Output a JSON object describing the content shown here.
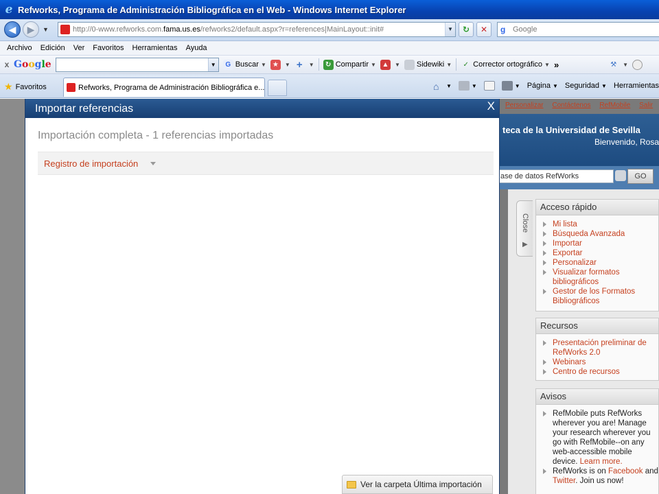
{
  "window": {
    "title": "Refworks, Programa de Administración Bibliográfica en el Web - Windows Internet Explorer"
  },
  "address": {
    "url_prefix": "http://0-www.refworks.com.",
    "url_domain": "fama.us.es",
    "url_suffix": "/refworks2/default.aspx?r=references|MainLayout::init#",
    "search_placeholder": "Google"
  },
  "menu": [
    "Archivo",
    "Edición",
    "Ver",
    "Favoritos",
    "Herramientas",
    "Ayuda"
  ],
  "google_toolbar": {
    "close": "x",
    "logo": [
      "G",
      "o",
      "o",
      "g",
      "l",
      "e"
    ],
    "buscar": "Buscar",
    "compartir": "Compartir",
    "sidewiki": "Sidewiki",
    "corrector": "Corrector ortográfico",
    "more": "»"
  },
  "tabs": {
    "favorites": "Favoritos",
    "active_tab": "Refworks, Programa de Administración Bibliográfica e...",
    "commands": [
      "Página",
      "Seguridad",
      "Herramientas"
    ]
  },
  "site": {
    "top_links": [
      "Personalizar",
      "Contáctenos",
      "RefMobile",
      "Salir"
    ],
    "library_title": "teca de la Universidad de Sevilla",
    "welcome": "Bienvenido, Rosa",
    "search_text": "ase de datos RefWorks",
    "go_label": "GO",
    "close_tab": "Close",
    "panels": {
      "quick_access": {
        "title": "Acceso rápido",
        "items": [
          "Mi lista",
          "Búsqueda Avanzada",
          "Importar",
          "Exportar",
          "Personalizar",
          "Visualizar formatos bibliográficos",
          "Gestor de los Formatos Bibliográficos"
        ]
      },
      "resources": {
        "title": "Recursos",
        "items": [
          "Presentación preliminar de RefWorks 2.0",
          "Webinars",
          "Centro de recursos"
        ]
      },
      "notices": {
        "title": "Avisos",
        "text1": "RefMobile puts RefWorks wherever you are! Manage your research wherever you go with RefMobile--on any web-accessible mobile device.",
        "learn_more": "Learn more.",
        "text2_prefix": "RefWorks is on",
        "facebook": "Facebook",
        "text2_mid": "and",
        "twitter": "Twitter",
        "text2_end": ". Join us now!"
      }
    }
  },
  "modal": {
    "title": "Importar referencias",
    "close": "X",
    "status": "Importación completa - 1 referencias importadas",
    "log_label": "Registro de importación",
    "folder_button": "Ver la carpeta Última importación"
  },
  "colors": {
    "title_bar": "#0842b0",
    "modal_header": "#173f73",
    "link": "#c5401f"
  }
}
